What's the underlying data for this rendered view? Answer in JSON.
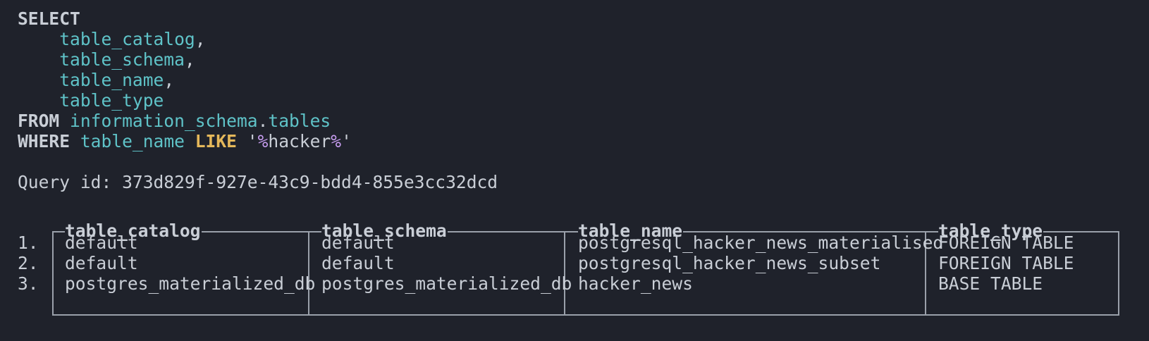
{
  "query": {
    "select_kw": "SELECT",
    "columns": [
      "table_catalog",
      "table_schema",
      "table_name",
      "table_type"
    ],
    "column_separators": [
      ",",
      ",",
      ",",
      ""
    ],
    "from_kw": "FROM",
    "from_schema": "information_schema",
    "from_dot": ".",
    "from_table": "tables",
    "where_kw": "WHERE",
    "where_column": "table_name",
    "like_kw": "LIKE",
    "pattern_quote": "'",
    "pattern_wildcard": "%",
    "pattern_text": "hacker"
  },
  "query_id": {
    "label": "Query id: ",
    "value": "373d829f-927e-43c9-bdd4-855e3cc32dcd"
  },
  "results": {
    "headers": [
      "table_catalog",
      "table_schema",
      "table_name",
      "table_type"
    ],
    "row_numbers": [
      "1.",
      "2.",
      "3."
    ],
    "rows": [
      [
        "default",
        "default",
        "postgresql_hacker_news_materialised",
        "FOREIGN TABLE"
      ],
      [
        "default",
        "default",
        "postgresql_hacker_news_subset",
        "FOREIGN TABLE"
      ],
      [
        "postgres_materialized_db",
        "postgres_materialized_db",
        "hacker_news",
        "BASE TABLE"
      ]
    ]
  },
  "colors": {
    "background": "#1f222b",
    "text": "#c9ced6",
    "identifier": "#5fc3c8",
    "operator_keyword": "#e5b85a",
    "wildcard": "#c79df0",
    "table_border": "#9aa0aa"
  }
}
